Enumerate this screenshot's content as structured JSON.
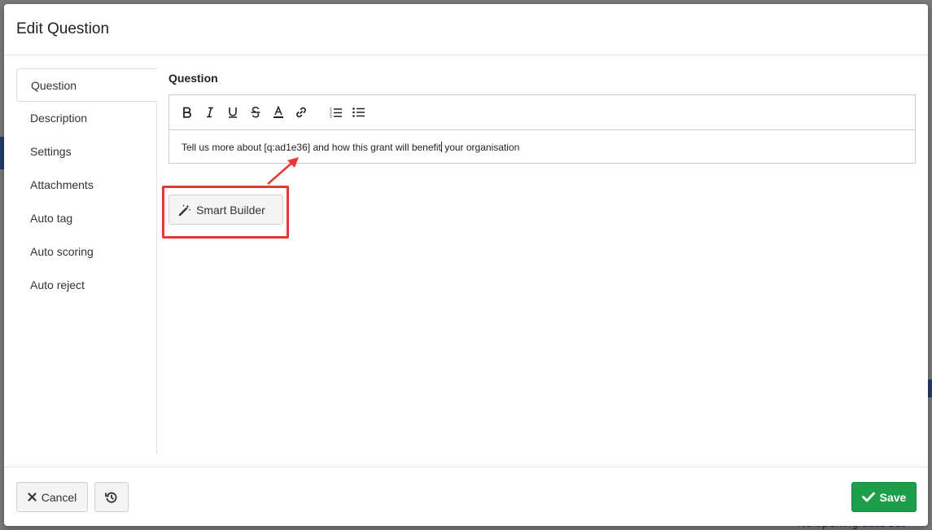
{
  "backdrop": {
    "partial_text": "No opening date set"
  },
  "modal": {
    "title": "Edit Question"
  },
  "nav": {
    "items": [
      {
        "label": "Question",
        "active": true
      },
      {
        "label": "Description",
        "active": false
      },
      {
        "label": "Settings",
        "active": false
      },
      {
        "label": "Attachments",
        "active": false
      },
      {
        "label": "Auto tag",
        "active": false
      },
      {
        "label": "Auto scoring",
        "active": false
      },
      {
        "label": "Auto reject",
        "active": false
      }
    ]
  },
  "editor": {
    "label": "Question",
    "toolbar_icons": [
      "bold-icon",
      "italic-icon",
      "underline-icon",
      "strikethrough-icon",
      "font-color-icon",
      "link-icon",
      "ordered-list-icon",
      "bullet-list-icon"
    ],
    "content_before_caret": "Tell us more about [q:ad1e36] and how this grant will benefit",
    "content_after_caret": " your organisation"
  },
  "smart_builder": {
    "label": "Smart Builder",
    "icon": "magic-wand-icon",
    "highlight_color": "#e53935"
  },
  "footer": {
    "cancel_label": "Cancel",
    "save_label": "Save",
    "history_icon": "history-icon",
    "save_color": "#1e9e4a"
  }
}
